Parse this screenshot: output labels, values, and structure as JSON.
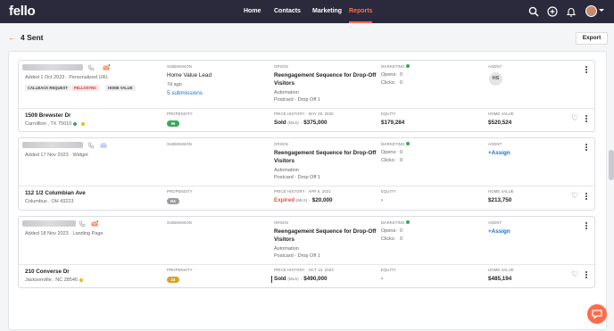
{
  "nav": {
    "logo": "fello",
    "items": [
      "Home",
      "Contacts",
      "Marketing",
      "Reports"
    ],
    "active": "Reports"
  },
  "page": {
    "title": "4 Sent",
    "export_label": "Export"
  },
  "labels": {
    "submission": "Submission",
    "origin": "Origin",
    "marketing": "Marketing",
    "agent": "Agent",
    "propensity": "Propensity",
    "equity": "Equity",
    "home_value": "Home Value",
    "opens": "Opens:",
    "clicks": "Clicks:",
    "mls": "(MLS)"
  },
  "cards": [
    {
      "added": "Added 1 Oct 2023 · Personalized URL",
      "tags": [
        "CALLBACK REQUEST",
        "FELLOSYNC",
        "HOME VALUE"
      ],
      "submission_title": "Home Value Lead",
      "submission_age": "7d ago",
      "submissions_link": "5 submissions",
      "origin_title": "Reengagement Sequence for Drop-Off Visitors",
      "origin_type": "Automation",
      "origin_step": "Postcard - Drop Off 1",
      "opens": "0",
      "clicks": "0",
      "agent_initials": "HS",
      "address": "1509 Brewster Dr",
      "city": "Carrollton , TX 75010",
      "propensity": "95",
      "propensity_color": "#3aa757",
      "price_label": "Price History · May 29, 2020",
      "price_status": "Sold",
      "price_value": "$375,000",
      "equity": "$179,284",
      "home_value": "$520,524"
    },
    {
      "added": "Added 17 Nov 2023 · Widget",
      "origin_title": "Reengagement Sequence for Drop-Off Visitors",
      "origin_type": "Automation",
      "origin_step": "Postcard - Drop Off 1",
      "opens": "0",
      "clicks": "0",
      "agent_assign": "+Assign",
      "address": "112 1/2 Columbian Ave",
      "city": "Columbus , OH 43223",
      "propensity": "NA",
      "propensity_color": "#9a9aa0",
      "price_label": "Price History · Apr 6, 2021",
      "price_status": "Expired",
      "price_value": "$20,000",
      "equity": "-",
      "home_value": "$213,750"
    },
    {
      "added": "Added 18 Nov 2023 · Landing Page",
      "origin_title": "Reengagement Sequence for Drop-Off Visitors",
      "origin_type": "Automation",
      "origin_step": "Postcard - Drop Off 1",
      "opens": "0",
      "clicks": "0",
      "agent_assign": "+Assign",
      "address": "210 Converse Dr",
      "city": "Jacksonville , NC 28546",
      "propensity": "24",
      "propensity_color": "#d9a521",
      "price_label": "Price History · Oct 13, 2023",
      "price_status": "Sold",
      "price_value": "$490,000",
      "equity": "-",
      "home_value": "$485,194"
    }
  ],
  "colors": {
    "accent": "#ff6b4a",
    "topbar": "#2b2a3d",
    "link": "#1a6fcf",
    "expired": "#e0533a",
    "marketing_dot": "#3aa757"
  }
}
